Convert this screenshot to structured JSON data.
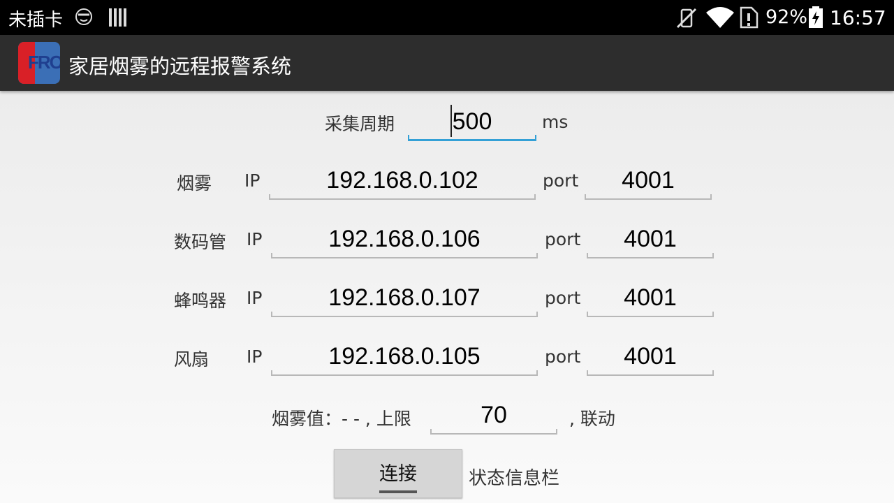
{
  "status_bar": {
    "carrier": "未插卡",
    "battery": "92%",
    "time": "16:57"
  },
  "app": {
    "title": "家居烟雾的远程报警系统",
    "icon_letters": "FRO"
  },
  "form": {
    "period_label": "采集周期",
    "period_value": "500",
    "period_unit": "ms",
    "ip_label": "IP",
    "port_label": "port",
    "devices": [
      {
        "name": "烟雾",
        "ip": "192.168.0.102",
        "port": "4001"
      },
      {
        "name": "数码管",
        "ip": "192.168.0.106",
        "port": "4001"
      },
      {
        "name": "蜂鸣器",
        "ip": "192.168.0.107",
        "port": "4001"
      },
      {
        "name": "风扇",
        "ip": "192.168.0.105",
        "port": "4001"
      }
    ],
    "smoke_prefix": "烟雾值：- - , 上限",
    "smoke_limit": "70",
    "smoke_suffix": ", 联动",
    "connect_label": "连接",
    "status_text": "状态信息栏"
  }
}
